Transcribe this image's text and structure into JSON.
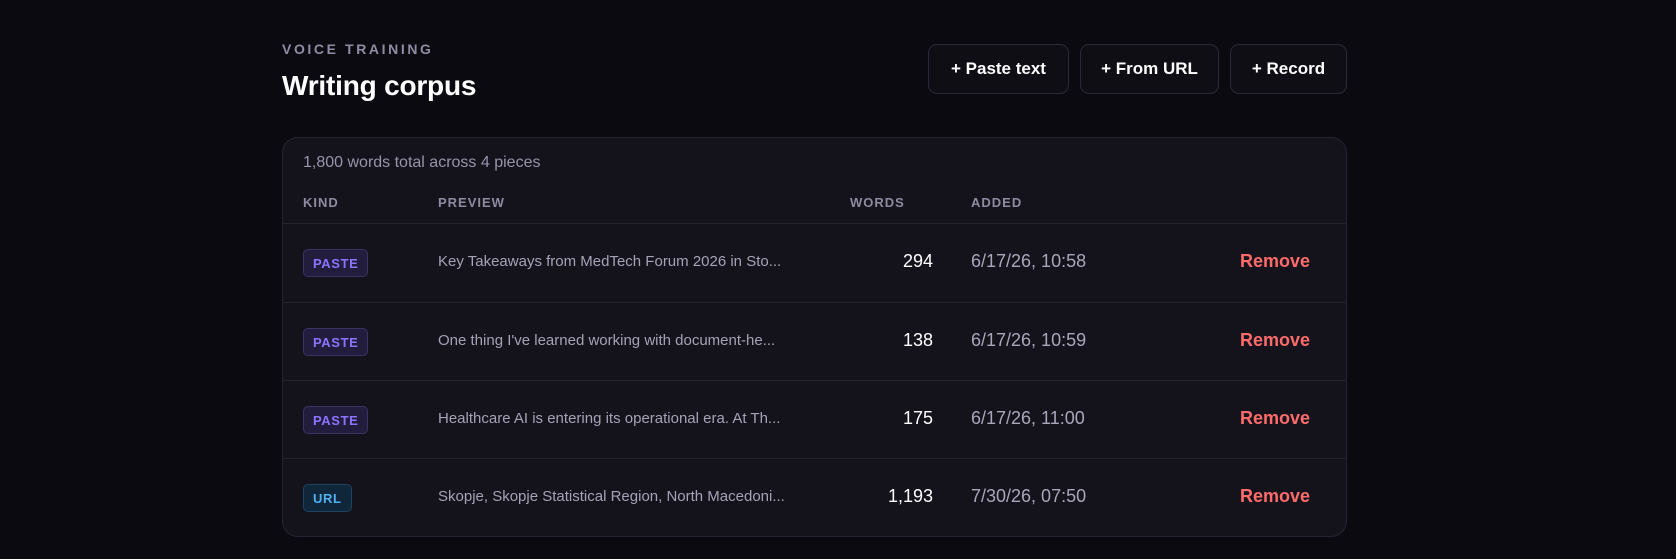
{
  "header": {
    "eyebrow": "VOICE TRAINING",
    "title": "Writing corpus"
  },
  "actions": {
    "paste_label": "+ Paste text",
    "url_label": "+ From URL",
    "record_label": "+ Record"
  },
  "corpus": {
    "summary": "1,800 words total across 4 pieces",
    "columns": {
      "kind": "KIND",
      "preview": "PREVIEW",
      "words": "WORDS",
      "added": "ADDED"
    },
    "rows": [
      {
        "kind": "PASTE",
        "preview": "Key Takeaways from MedTech Forum 2026 in Sto...",
        "words": "294",
        "added": "6/17/26, 10:58",
        "action": "Remove"
      },
      {
        "kind": "PASTE",
        "preview": "One thing I've learned working with document-he...",
        "words": "138",
        "added": "6/17/26, 10:59",
        "action": "Remove"
      },
      {
        "kind": "PASTE",
        "preview": "Healthcare AI is entering its operational era. At Th...",
        "words": "175",
        "added": "6/17/26, 11:00",
        "action": "Remove"
      },
      {
        "kind": "URL",
        "preview": "Skopje, Skopje Statistical Region, North Macedoni...",
        "words": "1,193",
        "added": "7/30/26, 07:50",
        "action": "Remove"
      }
    ]
  },
  "colors": {
    "background": "#0b0a10",
    "card": "#14131c",
    "paste_badge": "#8d73ff",
    "url_badge": "#4fb0f2",
    "remove": "#ff6b6b"
  }
}
